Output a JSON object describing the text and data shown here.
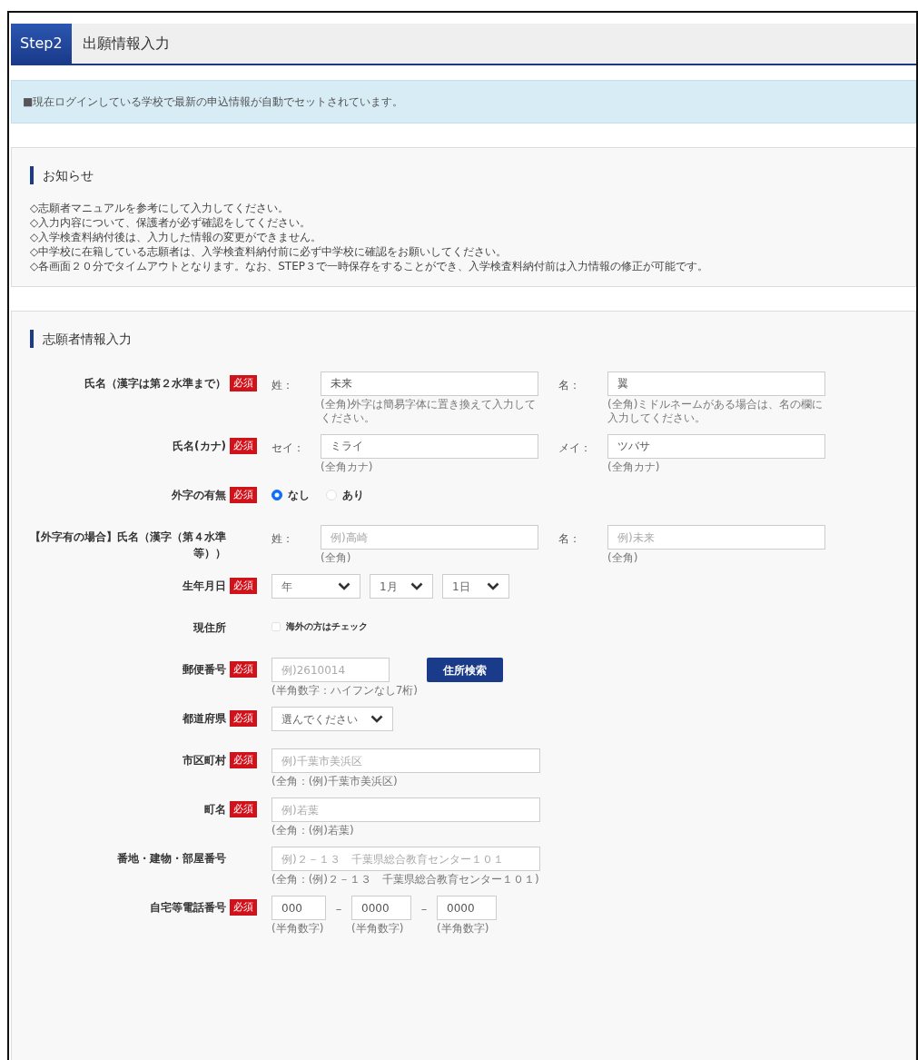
{
  "header": {
    "step": "Step2",
    "title": "出願情報入力"
  },
  "alert": "■現在ログインしている学校で最新の申込情報が自動でセットされています。",
  "notices": {
    "title": "お知らせ",
    "lines": [
      "◇志願者マニュアルを参考にして入力してください。",
      "◇入力内容について、保護者が必ず確認をしてください。",
      "◇入学検査料納付後は、入力した情報の変更ができません。",
      "◇中学校に在籍している志願者は、入学検査料納付前に必ず中学校に確認をお願いしてください。",
      "◇各画面２０分でタイムアウトとなります。なお、STEP３で一時保存をすることができ、入学検査料納付前は入力情報の修正が可能です。"
    ]
  },
  "form": {
    "title": "志願者情報入力",
    "rows": [
      {
        "kind": "pair",
        "label": "氏名（漢字は第２水準まで）",
        "badge": "必須",
        "fields": [
          {
            "label": "姓：",
            "value": "未来",
            "hint": "(全角)外字は簡易字体に置き換えて入力してください。"
          },
          {
            "label": "名：",
            "value": "翼",
            "hint": "(全角)ミドルネームがある場合は、名の欄に入力してください。"
          }
        ]
      },
      {
        "kind": "pair",
        "label": "氏名(カナ)",
        "badge": "必須",
        "fields": [
          {
            "label": "セイ：",
            "value": "ミライ",
            "hint": "(全角カナ)"
          },
          {
            "label": "メイ：",
            "value": "ツバサ",
            "hint": "(全角カナ)"
          }
        ]
      },
      {
        "kind": "radio",
        "label": "外字の有無",
        "badge": "必須",
        "options": [
          {
            "label": "なし",
            "selected": true
          },
          {
            "label": "あり",
            "selected": false
          }
        ]
      },
      {
        "kind": "pair",
        "label": "【外字有の場合】氏名（漢字（第４水準等））",
        "fields": [
          {
            "label": "姓：",
            "placeholder": "例)高崎",
            "hint": "(全角)"
          },
          {
            "label": "名：",
            "placeholder": "例)未来",
            "hint": "(全角)"
          }
        ]
      },
      {
        "kind": "selects",
        "label": "生年月日",
        "badge": "必須",
        "selects": [
          "年",
          "1月",
          "1日"
        ]
      },
      {
        "kind": "checkbox",
        "label": "現住所",
        "option": {
          "label": "海外の方はチェック",
          "checked": false
        }
      },
      {
        "kind": "postal",
        "label": "郵便番号",
        "badge": "必須",
        "placeholder": "例)2610014",
        "hint": "(半角数字：ハイフンなし7桁)",
        "button": "住所検索"
      },
      {
        "kind": "selects",
        "label": "都道府県",
        "badge": "必須",
        "selects": [
          "選んでください"
        ]
      },
      {
        "kind": "text",
        "label": "市区町村",
        "badge": "必須",
        "placeholder": "例)千葉市美浜区",
        "hint": "(全角：(例)千葉市美浜区)"
      },
      {
        "kind": "text",
        "label": "町名",
        "badge": "必須",
        "placeholder": "例)若葉",
        "hint": "(全角：(例)若葉)"
      },
      {
        "kind": "text",
        "label": "番地・建物・部屋番号",
        "placeholder": "例)２－１３　千葉県総合教育センター１０１",
        "hint": "(全角：(例)２－１３　千葉県総合教育センター１０１)"
      },
      {
        "kind": "phone",
        "label": "自宅等電話番号",
        "badge": "必須",
        "separator": "－",
        "parts": [
          {
            "value": "000",
            "hint": "(半角数字)"
          },
          {
            "value": "0000",
            "hint": "(半角数字)"
          },
          {
            "value": "0000",
            "hint": "(半角数字)"
          }
        ]
      }
    ]
  }
}
